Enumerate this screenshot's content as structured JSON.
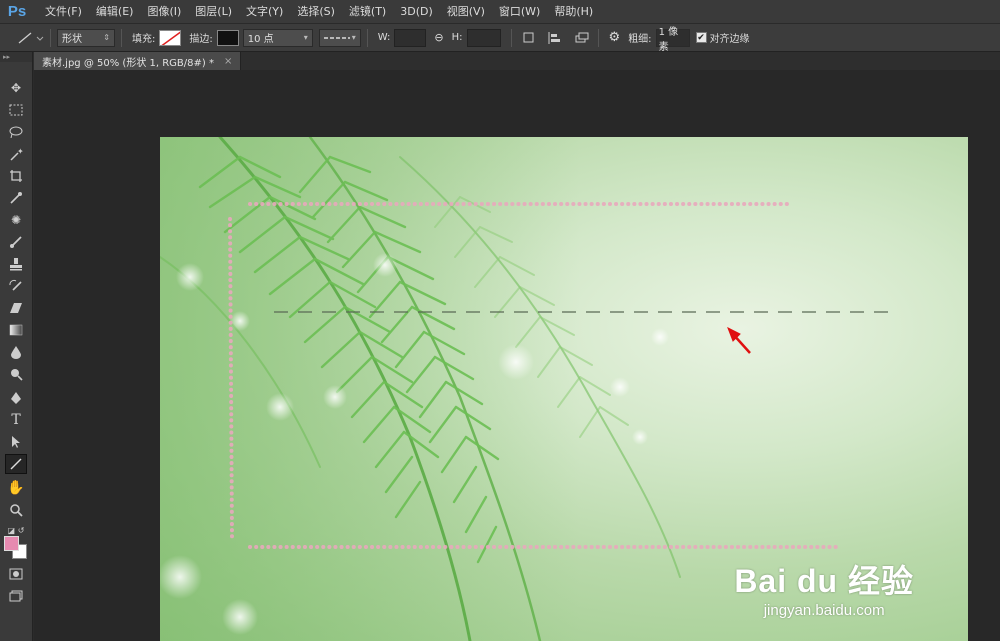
{
  "app": {
    "logo": "Ps"
  },
  "menu": [
    "文件(F)",
    "编辑(E)",
    "图像(I)",
    "图层(L)",
    "文字(Y)",
    "选择(S)",
    "滤镜(T)",
    "3D(D)",
    "视图(V)",
    "窗口(W)",
    "帮助(H)"
  ],
  "options": {
    "mode": "形状",
    "fill_label": "填充:",
    "stroke_label": "描边:",
    "stroke_width": "10 点",
    "w_label": "W:",
    "h_label": "H:",
    "weight_label": "粗细:",
    "weight_value": "1 像素",
    "align_edges_label": "对齐边缘",
    "align_edges_checked": true
  },
  "document_tab": {
    "title": "素材.jpg @ 50% (形状 1, RGB/8#) *",
    "close": "×"
  },
  "tools": [
    "move-icon",
    "marquee-icon",
    "lasso-icon",
    "magic-wand-icon",
    "crop-icon",
    "eyedropper-icon",
    "healing-brush-icon",
    "brush-icon",
    "clone-stamp-icon",
    "history-brush-icon",
    "eraser-icon",
    "gradient-icon",
    "blur-icon",
    "dodge-icon",
    "pen-icon",
    "type-icon",
    "path-selection-icon",
    "line-tool-icon",
    "hand-icon",
    "zoom-icon"
  ],
  "colors": {
    "foreground": "#e68ab0",
    "background": "#ffffff",
    "dot_border": "#e8a8bd",
    "arrow": "#e01010"
  },
  "watermark": {
    "logo": "Bai du 经验",
    "url": "jingyan.baidu.com"
  }
}
